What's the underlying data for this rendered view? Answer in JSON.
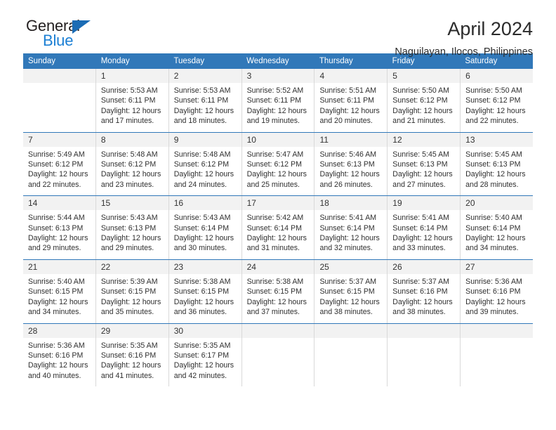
{
  "brand": {
    "name_top": "General",
    "name_bottom": "Blue",
    "accent_dark": "#1b6cb5",
    "accent_light": "#1b7fd4"
  },
  "header": {
    "title": "April 2024",
    "subtitle": "Naguilayan, Ilocos, Philippines"
  },
  "theme": {
    "header_blue": "#3178b9",
    "daynum_bg": "#f2f2f2",
    "grid_line": "#d9d9d9",
    "text": "#2f2f2f"
  },
  "calendar": {
    "weekdays": [
      "Sunday",
      "Monday",
      "Tuesday",
      "Wednesday",
      "Thursday",
      "Friday",
      "Saturday"
    ],
    "weeks": [
      [
        {
          "day": "",
          "sunrise": "",
          "sunset": "",
          "daylight_1": "",
          "daylight_2": "",
          "empty": true
        },
        {
          "day": "1",
          "sunrise": "Sunrise: 5:53 AM",
          "sunset": "Sunset: 6:11 PM",
          "daylight_1": "Daylight: 12 hours",
          "daylight_2": "and 17 minutes.",
          "empty": false
        },
        {
          "day": "2",
          "sunrise": "Sunrise: 5:53 AM",
          "sunset": "Sunset: 6:11 PM",
          "daylight_1": "Daylight: 12 hours",
          "daylight_2": "and 18 minutes.",
          "empty": false
        },
        {
          "day": "3",
          "sunrise": "Sunrise: 5:52 AM",
          "sunset": "Sunset: 6:11 PM",
          "daylight_1": "Daylight: 12 hours",
          "daylight_2": "and 19 minutes.",
          "empty": false
        },
        {
          "day": "4",
          "sunrise": "Sunrise: 5:51 AM",
          "sunset": "Sunset: 6:11 PM",
          "daylight_1": "Daylight: 12 hours",
          "daylight_2": "and 20 minutes.",
          "empty": false
        },
        {
          "day": "5",
          "sunrise": "Sunrise: 5:50 AM",
          "sunset": "Sunset: 6:12 PM",
          "daylight_1": "Daylight: 12 hours",
          "daylight_2": "and 21 minutes.",
          "empty": false
        },
        {
          "day": "6",
          "sunrise": "Sunrise: 5:50 AM",
          "sunset": "Sunset: 6:12 PM",
          "daylight_1": "Daylight: 12 hours",
          "daylight_2": "and 22 minutes.",
          "empty": false
        }
      ],
      [
        {
          "day": "7",
          "sunrise": "Sunrise: 5:49 AM",
          "sunset": "Sunset: 6:12 PM",
          "daylight_1": "Daylight: 12 hours",
          "daylight_2": "and 22 minutes.",
          "empty": false
        },
        {
          "day": "8",
          "sunrise": "Sunrise: 5:48 AM",
          "sunset": "Sunset: 6:12 PM",
          "daylight_1": "Daylight: 12 hours",
          "daylight_2": "and 23 minutes.",
          "empty": false
        },
        {
          "day": "9",
          "sunrise": "Sunrise: 5:48 AM",
          "sunset": "Sunset: 6:12 PM",
          "daylight_1": "Daylight: 12 hours",
          "daylight_2": "and 24 minutes.",
          "empty": false
        },
        {
          "day": "10",
          "sunrise": "Sunrise: 5:47 AM",
          "sunset": "Sunset: 6:12 PM",
          "daylight_1": "Daylight: 12 hours",
          "daylight_2": "and 25 minutes.",
          "empty": false
        },
        {
          "day": "11",
          "sunrise": "Sunrise: 5:46 AM",
          "sunset": "Sunset: 6:13 PM",
          "daylight_1": "Daylight: 12 hours",
          "daylight_2": "and 26 minutes.",
          "empty": false
        },
        {
          "day": "12",
          "sunrise": "Sunrise: 5:45 AM",
          "sunset": "Sunset: 6:13 PM",
          "daylight_1": "Daylight: 12 hours",
          "daylight_2": "and 27 minutes.",
          "empty": false
        },
        {
          "day": "13",
          "sunrise": "Sunrise: 5:45 AM",
          "sunset": "Sunset: 6:13 PM",
          "daylight_1": "Daylight: 12 hours",
          "daylight_2": "and 28 minutes.",
          "empty": false
        }
      ],
      [
        {
          "day": "14",
          "sunrise": "Sunrise: 5:44 AM",
          "sunset": "Sunset: 6:13 PM",
          "daylight_1": "Daylight: 12 hours",
          "daylight_2": "and 29 minutes.",
          "empty": false
        },
        {
          "day": "15",
          "sunrise": "Sunrise: 5:43 AM",
          "sunset": "Sunset: 6:13 PM",
          "daylight_1": "Daylight: 12 hours",
          "daylight_2": "and 29 minutes.",
          "empty": false
        },
        {
          "day": "16",
          "sunrise": "Sunrise: 5:43 AM",
          "sunset": "Sunset: 6:14 PM",
          "daylight_1": "Daylight: 12 hours",
          "daylight_2": "and 30 minutes.",
          "empty": false
        },
        {
          "day": "17",
          "sunrise": "Sunrise: 5:42 AM",
          "sunset": "Sunset: 6:14 PM",
          "daylight_1": "Daylight: 12 hours",
          "daylight_2": "and 31 minutes.",
          "empty": false
        },
        {
          "day": "18",
          "sunrise": "Sunrise: 5:41 AM",
          "sunset": "Sunset: 6:14 PM",
          "daylight_1": "Daylight: 12 hours",
          "daylight_2": "and 32 minutes.",
          "empty": false
        },
        {
          "day": "19",
          "sunrise": "Sunrise: 5:41 AM",
          "sunset": "Sunset: 6:14 PM",
          "daylight_1": "Daylight: 12 hours",
          "daylight_2": "and 33 minutes.",
          "empty": false
        },
        {
          "day": "20",
          "sunrise": "Sunrise: 5:40 AM",
          "sunset": "Sunset: 6:14 PM",
          "daylight_1": "Daylight: 12 hours",
          "daylight_2": "and 34 minutes.",
          "empty": false
        }
      ],
      [
        {
          "day": "21",
          "sunrise": "Sunrise: 5:40 AM",
          "sunset": "Sunset: 6:15 PM",
          "daylight_1": "Daylight: 12 hours",
          "daylight_2": "and 34 minutes.",
          "empty": false
        },
        {
          "day": "22",
          "sunrise": "Sunrise: 5:39 AM",
          "sunset": "Sunset: 6:15 PM",
          "daylight_1": "Daylight: 12 hours",
          "daylight_2": "and 35 minutes.",
          "empty": false
        },
        {
          "day": "23",
          "sunrise": "Sunrise: 5:38 AM",
          "sunset": "Sunset: 6:15 PM",
          "daylight_1": "Daylight: 12 hours",
          "daylight_2": "and 36 minutes.",
          "empty": false
        },
        {
          "day": "24",
          "sunrise": "Sunrise: 5:38 AM",
          "sunset": "Sunset: 6:15 PM",
          "daylight_1": "Daylight: 12 hours",
          "daylight_2": "and 37 minutes.",
          "empty": false
        },
        {
          "day": "25",
          "sunrise": "Sunrise: 5:37 AM",
          "sunset": "Sunset: 6:15 PM",
          "daylight_1": "Daylight: 12 hours",
          "daylight_2": "and 38 minutes.",
          "empty": false
        },
        {
          "day": "26",
          "sunrise": "Sunrise: 5:37 AM",
          "sunset": "Sunset: 6:16 PM",
          "daylight_1": "Daylight: 12 hours",
          "daylight_2": "and 38 minutes.",
          "empty": false
        },
        {
          "day": "27",
          "sunrise": "Sunrise: 5:36 AM",
          "sunset": "Sunset: 6:16 PM",
          "daylight_1": "Daylight: 12 hours",
          "daylight_2": "and 39 minutes.",
          "empty": false
        }
      ],
      [
        {
          "day": "28",
          "sunrise": "Sunrise: 5:36 AM",
          "sunset": "Sunset: 6:16 PM",
          "daylight_1": "Daylight: 12 hours",
          "daylight_2": "and 40 minutes.",
          "empty": false
        },
        {
          "day": "29",
          "sunrise": "Sunrise: 5:35 AM",
          "sunset": "Sunset: 6:16 PM",
          "daylight_1": "Daylight: 12 hours",
          "daylight_2": "and 41 minutes.",
          "empty": false
        },
        {
          "day": "30",
          "sunrise": "Sunrise: 5:35 AM",
          "sunset": "Sunset: 6:17 PM",
          "daylight_1": "Daylight: 12 hours",
          "daylight_2": "and 42 minutes.",
          "empty": false
        },
        {
          "day": "",
          "sunrise": "",
          "sunset": "",
          "daylight_1": "",
          "daylight_2": "",
          "empty": true
        },
        {
          "day": "",
          "sunrise": "",
          "sunset": "",
          "daylight_1": "",
          "daylight_2": "",
          "empty": true
        },
        {
          "day": "",
          "sunrise": "",
          "sunset": "",
          "daylight_1": "",
          "daylight_2": "",
          "empty": true
        },
        {
          "day": "",
          "sunrise": "",
          "sunset": "",
          "daylight_1": "",
          "daylight_2": "",
          "empty": true
        }
      ]
    ]
  }
}
